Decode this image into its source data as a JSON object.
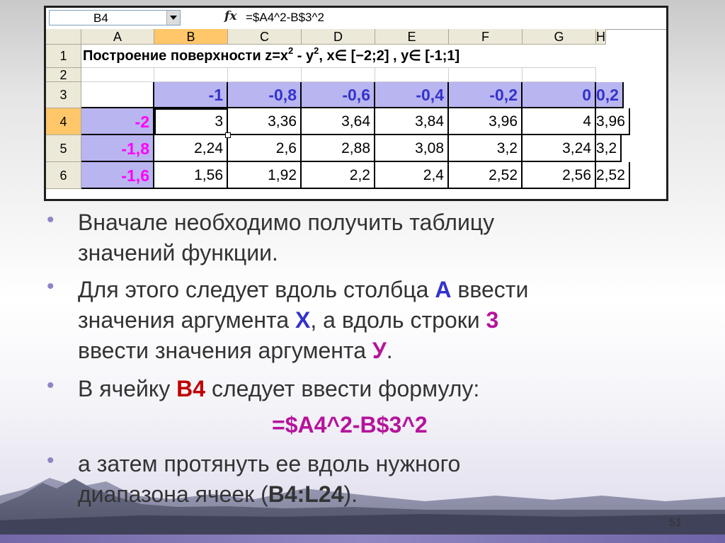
{
  "formula_bar": {
    "name_box": "B4",
    "fx_label": "fx",
    "formula": "=$A4^2-B$3^2"
  },
  "columns": [
    "A",
    "B",
    "C",
    "D",
    "E",
    "F",
    "G",
    "H"
  ],
  "rows": [
    "1",
    "2",
    "3",
    "4",
    "5",
    "6"
  ],
  "title_parts": {
    "a": "Построение поверхности z=x",
    "sup1": "2",
    "b": " - y",
    "sup2": "2",
    "c": ", x∈ [−2;2] ,  y∈ [-1;1]"
  },
  "y_values": [
    "-1",
    "-0,8",
    "-0,6",
    "-0,4",
    "-0,2",
    "0",
    "0,2"
  ],
  "x_values": [
    "-2",
    "-1,8",
    "-1,6"
  ],
  "values": [
    [
      "3",
      "3,36",
      "3,64",
      "3,84",
      "3,96",
      "4",
      "3,96"
    ],
    [
      "2,24",
      "2,6",
      "2,88",
      "3,08",
      "3,2",
      "3,24",
      "3,2"
    ],
    [
      "1,56",
      "1,92",
      "2,2",
      "2,4",
      "2,52",
      "2,56",
      "2,52"
    ]
  ],
  "bullets": {
    "b1_l1": "Вначале необходимо получить таблицу",
    "b1_l2": "значений функции.",
    "b2_l1a": "Для этого следует вдоль столбца ",
    "b2_l1k": "А",
    "b2_l1b": " ввести",
    "b2_l2a": "значения аргумента ",
    "b2_l2k": "Х",
    "b2_l2b": ", а вдоль строки ",
    "b2_l2k2": "3",
    "b2_l3a": "ввести значения аргумента ",
    "b2_l3k": "У",
    "b2_l3b": ".",
    "b3_a": "В ячейку ",
    "b3_k": "В4",
    "b3_b": " следует ввести формулу:",
    "formula": "=$A4^2-B$3^2",
    "b4_l1": "а затем протянуть ее вдоль нужного",
    "b4_l2a": "диапазона ячеек (",
    "b4_l2k": "В4:L24",
    "b4_l2b": ")."
  },
  "page_number": "51",
  "colors": {
    "accent_purple": "#8c86c7",
    "header_selected": "#ffc66a",
    "cell_fill": "#b9b5f0",
    "keyword_blue": "#3333cc",
    "keyword_magenta": "#b5149b",
    "keyword_red": "#c00000"
  }
}
